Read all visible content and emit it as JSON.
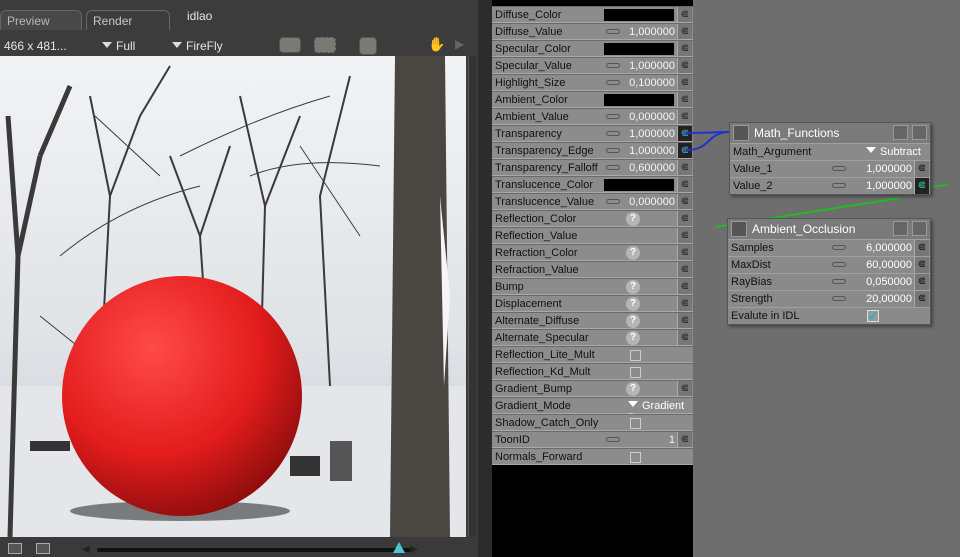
{
  "tabs": [
    {
      "label": "Preview"
    },
    {
      "label": "Render"
    }
  ],
  "render_name": "idlao",
  "toolbar": {
    "size": "466 x 481...",
    "resolution": "Full",
    "renderer": "FireFly"
  },
  "slider": {
    "value_percent": 96
  },
  "material": {
    "rows": [
      {
        "label": "Diffuse_Color",
        "kind": "color",
        "swatch": "#000000"
      },
      {
        "label": "Diffuse_Value",
        "kind": "value",
        "value": "1,000000"
      },
      {
        "label": "Specular_Color",
        "kind": "color",
        "swatch": "#000000"
      },
      {
        "label": "Specular_Value",
        "kind": "value",
        "value": "1,000000"
      },
      {
        "label": "Highlight_Size",
        "kind": "value",
        "value": "0,100000"
      },
      {
        "label": "Ambient_Color",
        "kind": "color",
        "swatch": "#000000"
      },
      {
        "label": "Ambient_Value",
        "kind": "value",
        "value": "0,000000"
      },
      {
        "label": "Transparency",
        "kind": "value",
        "value": "1,000000",
        "connected": true
      },
      {
        "label": "Transparency_Edge",
        "kind": "value",
        "value": "1,000000",
        "connected": true
      },
      {
        "label": "Transparency_Falloff",
        "kind": "value",
        "value": "0,600000"
      },
      {
        "label": "Translucence_Color",
        "kind": "color",
        "swatch": "#000000"
      },
      {
        "label": "Translucence_Value",
        "kind": "value",
        "value": "0,000000"
      },
      {
        "label": "Reflection_Color",
        "kind": "question"
      },
      {
        "label": "Reflection_Value",
        "kind": "empty"
      },
      {
        "label": "Refraction_Color",
        "kind": "question"
      },
      {
        "label": "Refraction_Value",
        "kind": "empty"
      },
      {
        "label": "Bump",
        "kind": "question"
      },
      {
        "label": "Displacement",
        "kind": "question"
      },
      {
        "label": "Alternate_Diffuse",
        "kind": "question"
      },
      {
        "label": "Alternate_Specular",
        "kind": "question"
      },
      {
        "label": "Reflection_Lite_Mult",
        "kind": "checkbox"
      },
      {
        "label": "Reflection_Kd_Mult",
        "kind": "checkbox"
      },
      {
        "label": "Gradient_Bump",
        "kind": "question"
      },
      {
        "label": "Gradient_Mode",
        "kind": "dropdown",
        "value": "Gradient Bump"
      },
      {
        "label": "Shadow_Catch_Only",
        "kind": "checkbox"
      },
      {
        "label": "ToonID",
        "kind": "value",
        "value": "1"
      },
      {
        "label": "Normals_Forward",
        "kind": "checkbox"
      }
    ]
  },
  "math_node": {
    "title": "Math_Functions",
    "argument_label": "Math_Argument",
    "argument_value": "Subtract",
    "rows": [
      {
        "label": "Value_1",
        "value": "1,000000"
      },
      {
        "label": "Value_2",
        "value": "1,000000"
      }
    ]
  },
  "ao_node": {
    "title": "Ambient_Occlusion",
    "rows": [
      {
        "label": "Samples",
        "value": "6,000000"
      },
      {
        "label": "MaxDist",
        "value": "60,00000"
      },
      {
        "label": "RayBias",
        "value": "0,050000"
      },
      {
        "label": "Strength",
        "value": "20,00000"
      }
    ],
    "checkbox_label": "Evalute in IDL",
    "checkbox_checked": true
  },
  "colors": {
    "sphere": "#e02020",
    "wire_blue": "#2233cc",
    "wire_green": "#22bb22"
  }
}
